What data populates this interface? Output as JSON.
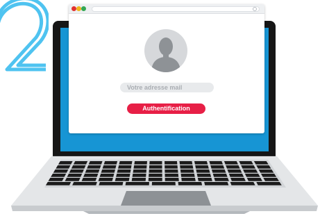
{
  "login": {
    "email_placeholder": "Votre adresse mail",
    "submit_label": "Authentification"
  },
  "icons": {
    "background_digit": "digit-two-outline-icon",
    "user": "user-avatar-icon"
  },
  "colors": {
    "screen": "#1795d4",
    "button": "#e71f46",
    "digit_outline": "#4fc3f0"
  }
}
